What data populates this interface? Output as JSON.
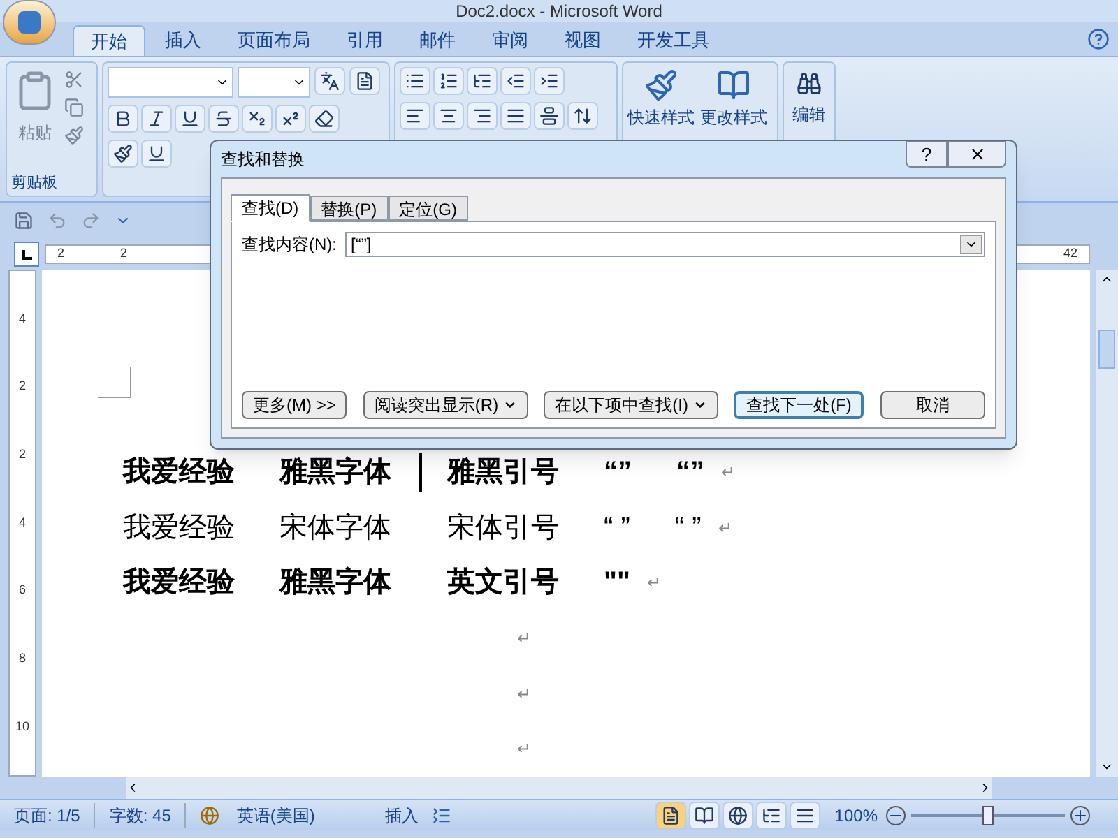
{
  "window": {
    "title": "Doc2.docx - Microsoft Word"
  },
  "ribbon_tabs": [
    {
      "label": "开始",
      "selected": true
    },
    {
      "label": "插入",
      "selected": false
    },
    {
      "label": "页面布局",
      "selected": false
    },
    {
      "label": "引用",
      "selected": false
    },
    {
      "label": "邮件",
      "selected": false
    },
    {
      "label": "审阅",
      "selected": false
    },
    {
      "label": "视图",
      "selected": false
    },
    {
      "label": "开发工具",
      "selected": false
    }
  ],
  "clipboard": {
    "paste": "粘贴",
    "group_label": "剪贴板"
  },
  "styles": {
    "quick_styles": "快速样式",
    "change_styles": "更改样式"
  },
  "editing": {
    "label": "编辑"
  },
  "ruler": {
    "left_labels": [
      "2",
      "2"
    ],
    "right_label": "42"
  },
  "vertical_ruler": [
    "4",
    "2",
    "2",
    "4",
    "6",
    "8",
    "10"
  ],
  "document": {
    "lines": [
      {
        "bold": true,
        "segments": [
          "我爱经验",
          "雅黑字体",
          "雅黑引号",
          "“”",
          "“”"
        ],
        "mark": "↵",
        "cursor": true
      },
      {
        "bold": false,
        "segments": [
          "我爱经验",
          "宋体字体",
          "宋体引号",
          "“ ”",
          "“ ”"
        ],
        "mark": "↵",
        "cursor": false
      },
      {
        "bold": true,
        "segments": [
          "我爱经验",
          "雅黑字体",
          "英文引号",
          "\"\""
        ],
        "mark": "↵",
        "cursor": false
      }
    ],
    "empty_marks": [
      "↵",
      "↵",
      "↵"
    ]
  },
  "dialog": {
    "title": "查找和替换",
    "help": "?",
    "tabs": [
      {
        "label": "查找(D)",
        "selected": true
      },
      {
        "label": "替换(P)",
        "selected": false
      },
      {
        "label": "定位(G)",
        "selected": false
      }
    ],
    "find_label": "查找内容(N):",
    "find_value": "[“”]",
    "buttons": [
      {
        "label": "更多(M) >>",
        "kind": "plain",
        "default": false
      },
      {
        "label": "阅读突出显示(R)",
        "kind": "menu",
        "default": false
      },
      {
        "label": "在以下项中查找(I)",
        "kind": "menu",
        "default": false
      },
      {
        "label": "查找下一处(F)",
        "kind": "plain",
        "default": true
      },
      {
        "label": "取消",
        "kind": "plain",
        "default": false
      }
    ]
  },
  "status_bar": {
    "page": "页面: 1/5",
    "words": "字数: 45",
    "language": "英语(美国)",
    "mode": "插入",
    "zoom": "100%",
    "zoom_slider": {
      "level": 0.5
    }
  }
}
